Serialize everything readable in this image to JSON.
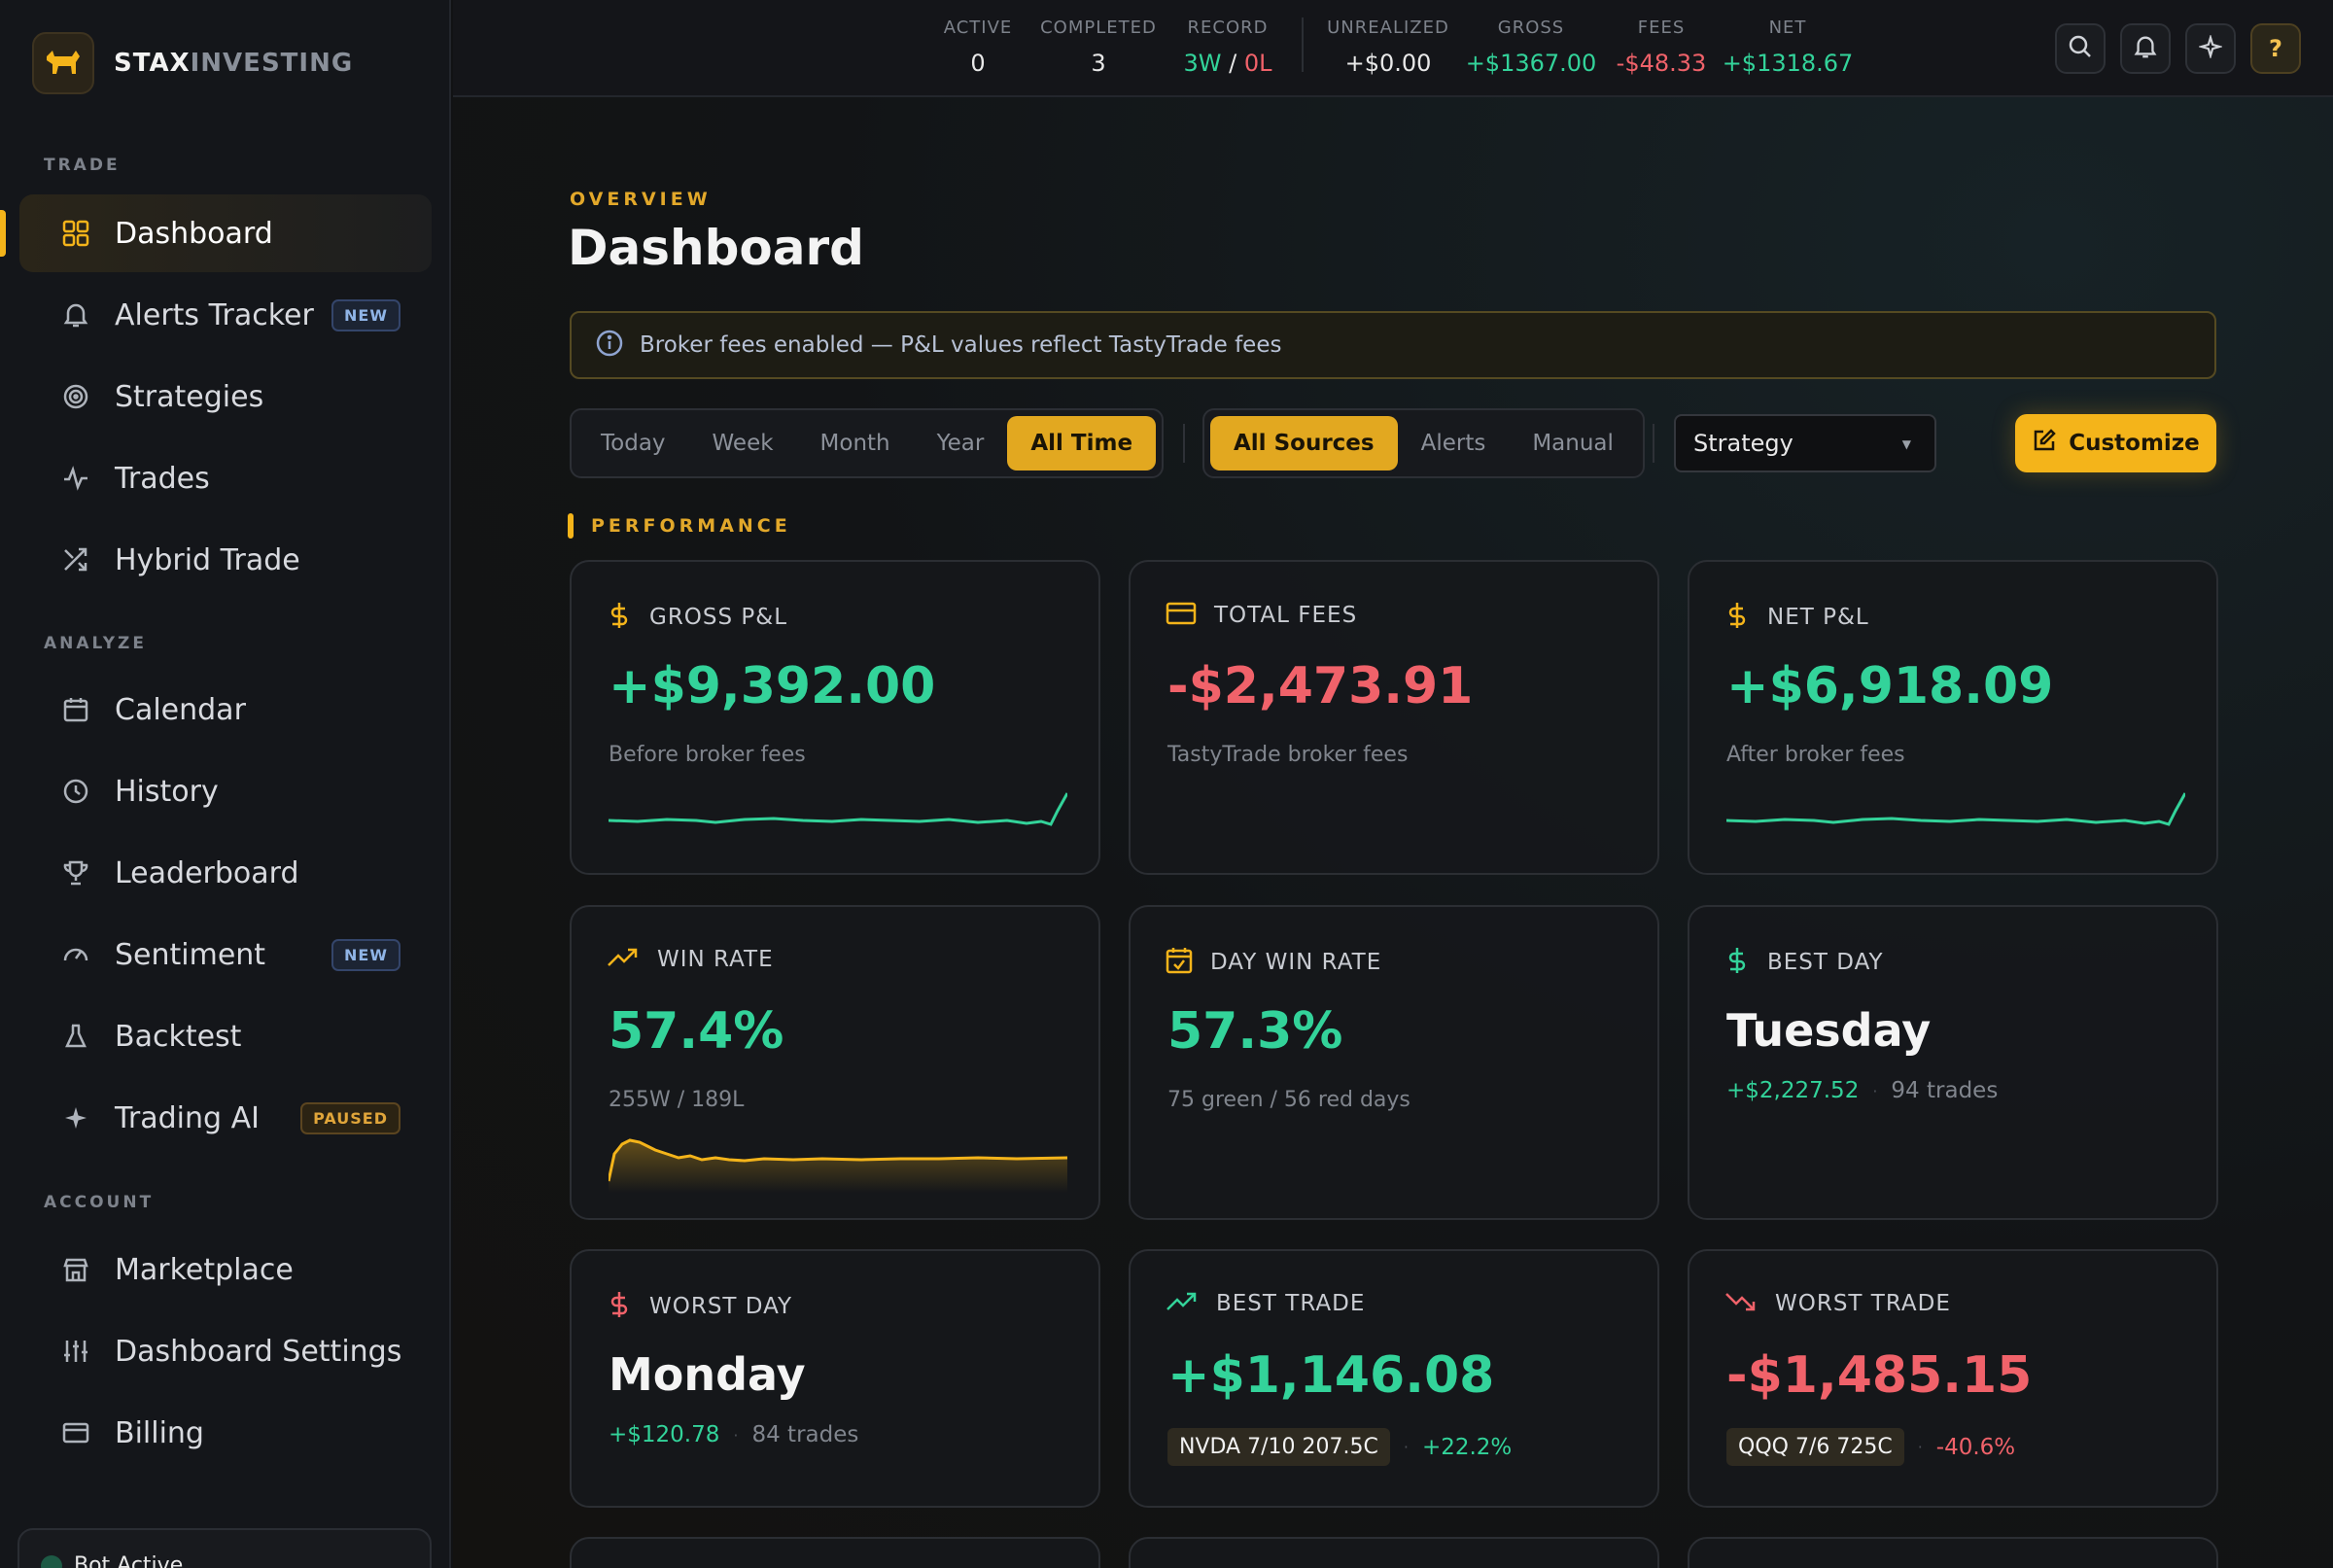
{
  "brand": {
    "name_strong": "STAX",
    "name_light": "INVESTING"
  },
  "sidebar": {
    "sections": {
      "trade": "TRADE",
      "analyze": "ANALYZE",
      "account": "ACCOUNT"
    },
    "items": [
      {
        "label": "Dashboard"
      },
      {
        "label": "Alerts Tracker",
        "badge": "NEW"
      },
      {
        "label": "Strategies"
      },
      {
        "label": "Trades"
      },
      {
        "label": "Hybrid Trade"
      },
      {
        "label": "Calendar"
      },
      {
        "label": "History"
      },
      {
        "label": "Leaderboard"
      },
      {
        "label": "Sentiment",
        "badge": "NEW"
      },
      {
        "label": "Backtest"
      },
      {
        "label": "Trading AI",
        "badge": "PAUSED"
      },
      {
        "label": "Marketplace"
      },
      {
        "label": "Dashboard Settings"
      },
      {
        "label": "Billing"
      }
    ],
    "bot_status": "Bot Active"
  },
  "topbar": {
    "active": {
      "label": "ACTIVE",
      "value": "0"
    },
    "completed": {
      "label": "COMPLETED",
      "value": "3"
    },
    "record": {
      "label": "RECORD",
      "wins": "3W",
      "sep": "/",
      "losses": "0L"
    },
    "unrealized": {
      "label": "UNREALIZED",
      "value": "+$0.00"
    },
    "gross": {
      "label": "GROSS",
      "value": "+$1367.00"
    },
    "fees": {
      "label": "FEES",
      "value": "-$48.33"
    },
    "net": {
      "label": "NET",
      "value": "+$1318.67"
    },
    "help": "?"
  },
  "page": {
    "eyebrow": "OVERVIEW",
    "title": "Dashboard",
    "notice": "Broker fees enabled — P&L values reflect TastyTrade fees"
  },
  "filters": {
    "periods": [
      "Today",
      "Week",
      "Month",
      "Year",
      "All Time"
    ],
    "period_selected": "All Time",
    "sources": [
      "All Sources",
      "Alerts",
      "Manual"
    ],
    "source_selected": "All Sources",
    "strategy_select": "Strategy",
    "customize": "Customize"
  },
  "performance": {
    "label": "PERFORMANCE",
    "gross_pnl": {
      "title": "GROSS P&L",
      "value": "+$9,392.00",
      "sub": "Before broker fees"
    },
    "total_fees": {
      "title": "TOTAL FEES",
      "value": "-$2,473.91",
      "sub": "TastyTrade broker fees"
    },
    "net_pnl": {
      "title": "NET P&L",
      "value": "+$6,918.09",
      "sub": "After broker fees"
    },
    "win_rate": {
      "title": "WIN RATE",
      "value": "57.4%",
      "sub": "255W / 189L"
    },
    "day_win_rate": {
      "title": "DAY WIN RATE",
      "value": "57.3%",
      "sub": "75 green / 56 red days"
    },
    "best_day": {
      "title": "BEST DAY",
      "day": "Tuesday",
      "amount": "+$2,227.52",
      "trades": "94 trades"
    },
    "worst_day": {
      "title": "WORST DAY",
      "day": "Monday",
      "amount": "+$120.78",
      "trades": "84 trades"
    },
    "best_trade": {
      "title": "BEST TRADE",
      "value": "+$1,146.08",
      "contract": "NVDA 7/10 207.5C",
      "pct": "+22.2%"
    },
    "worst_trade": {
      "title": "WORST TRADE",
      "value": "-$1,485.15",
      "contract": "QQQ 7/6 725C",
      "pct": "-40.6%"
    }
  },
  "colors": {
    "accent": "#f4b41a",
    "positive": "#33d39a",
    "negative": "#f0626a"
  }
}
